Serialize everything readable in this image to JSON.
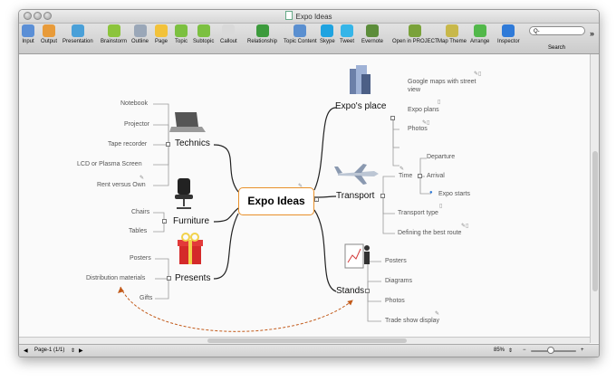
{
  "window": {
    "title": "Expo Ideas"
  },
  "toolbar": {
    "items": [
      {
        "label": "Input",
        "icon": "input-icon",
        "color": "#5b8fd6"
      },
      {
        "label": "Output",
        "icon": "output-icon",
        "color": "#e89b3a"
      },
      {
        "label": "Presentation",
        "icon": "presentation-icon",
        "color": "#4aa0d8"
      },
      {
        "label": "Brainstorm",
        "icon": "brainstorm-icon",
        "color": "#8cc43c"
      },
      {
        "label": "Outline",
        "icon": "outline-icon",
        "color": "#9aa7b8"
      },
      {
        "label": "Page",
        "icon": "page-icon",
        "color": "#f2c23a"
      },
      {
        "label": "Topic",
        "icon": "topic-icon",
        "color": "#7cc040"
      },
      {
        "label": "Subtopic",
        "icon": "subtopic-icon",
        "color": "#7cc040"
      },
      {
        "label": "Callout",
        "icon": "callout-icon",
        "color": "#d9d9d9"
      },
      {
        "label": "Relationship",
        "icon": "relationship-icon",
        "color": "#3d9b3d"
      },
      {
        "label": "Topic Content",
        "icon": "topic-content-icon",
        "color": "#5a8fd0"
      },
      {
        "label": "Skype",
        "icon": "skype-icon",
        "color": "#1fa3e0"
      },
      {
        "label": "Tweet",
        "icon": "tweet-icon",
        "color": "#35b5e8"
      },
      {
        "label": "Evernote",
        "icon": "evernote-icon",
        "color": "#5c8d3a"
      },
      {
        "label": "Open in PROJECT",
        "icon": "project-icon",
        "color": "#7aa23a"
      },
      {
        "label": "Map Theme",
        "icon": "map-theme-icon",
        "color": "#c8b84a"
      },
      {
        "label": "Arrange",
        "icon": "arrange-icon",
        "color": "#52b84a"
      },
      {
        "label": "Inspector",
        "icon": "inspector-icon",
        "color": "#2f7ad8"
      }
    ],
    "search": {
      "label": "Search",
      "placeholder": "Q-"
    }
  },
  "status": {
    "page": "Page-1 (1/1)",
    "zoom": "85%",
    "zoom_level": 0.4
  },
  "map": {
    "central": "Expo Ideas",
    "topics": {
      "expos_place": "Expo's place",
      "technics": "Technics",
      "transport": "Transport",
      "furniture": "Furniture",
      "presents": "Presents",
      "stands": "Stands"
    },
    "subtopics": {
      "google_maps_1": "Google maps with street",
      "google_maps_2": "view",
      "expo_plans": "Expo plans",
      "photos_place": "Photos",
      "notebook": "Notebook",
      "projector": "Projector",
      "tape_recorder": "Tape recorder",
      "lcd": "LCD or Plasma Screen",
      "rent": "Rent versus Own",
      "time": "Time",
      "departure": "Departure",
      "arrival": "Arrival",
      "expo_starts": "Expo starts",
      "transport_type": "Transport type",
      "best_route": "Defining the best route",
      "chairs": "Chairs",
      "tables": "Tables",
      "posters_presents": "Posters",
      "distribution": "Distribution materials",
      "gifts": "Gifts",
      "posters_stands": "Posters",
      "diagrams": "Diagrams",
      "photos_stands": "Photos",
      "trade_show": "Trade show display"
    }
  }
}
